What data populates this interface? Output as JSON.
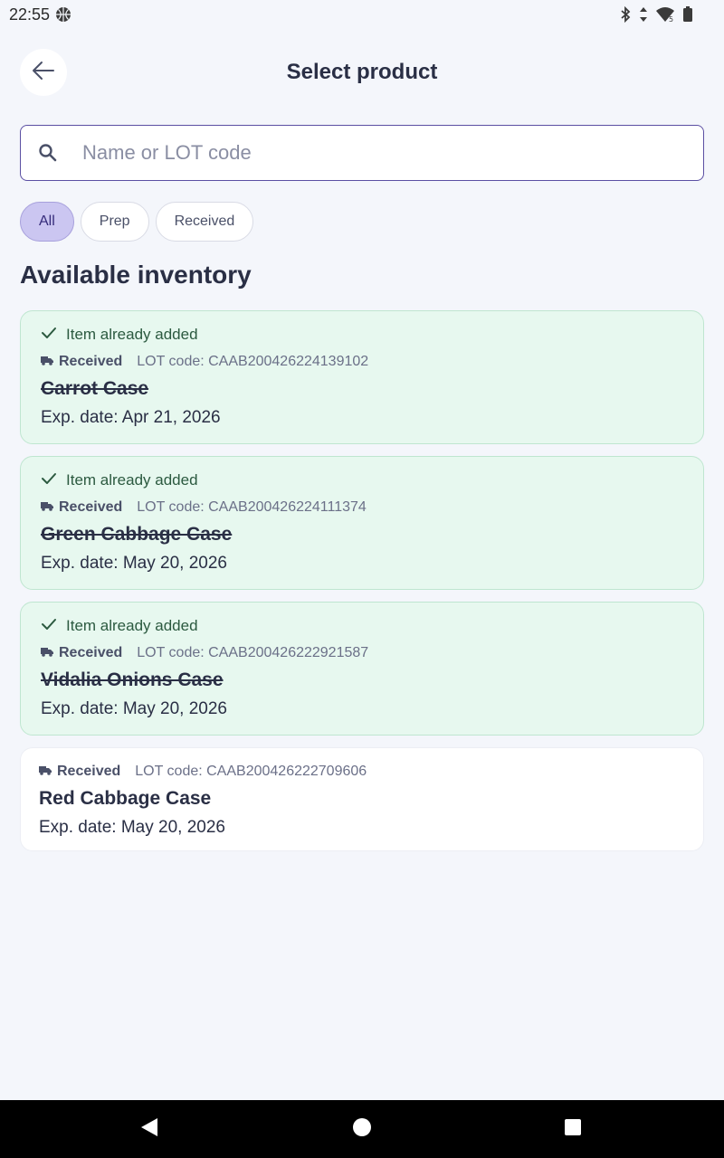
{
  "status_bar": {
    "time": "22:55"
  },
  "header": {
    "title": "Select product"
  },
  "search": {
    "placeholder": "Name or LOT code",
    "value": ""
  },
  "filters": [
    {
      "label": "All",
      "active": true
    },
    {
      "label": "Prep",
      "active": false
    },
    {
      "label": "Received",
      "active": false
    }
  ],
  "section_title": "Available inventory",
  "items": [
    {
      "added_label": "Item already added",
      "status": "Received",
      "lot": "LOT code: CAAB200426224139102",
      "name": "Carrot Case",
      "exp": "Exp. date: Apr 21, 2026"
    },
    {
      "added_label": "Item already added",
      "status": "Received",
      "lot": "LOT code: CAAB200426224111374",
      "name": "Green Cabbage Case",
      "exp": "Exp. date: May 20, 2026"
    },
    {
      "added_label": "Item already added",
      "status": "Received",
      "lot": "LOT code: CAAB200426222921587",
      "name": "Vidalia Onions Case",
      "exp": "Exp. date: May 20, 2026"
    },
    {
      "status": "Received",
      "lot": "LOT code: CAAB200426222709606",
      "name": "Red Cabbage Case",
      "exp": "Exp. date: May 20, 2026"
    }
  ],
  "colors": {
    "accent": "#5b4fa3",
    "added_bg": "#e7f8ef",
    "chip_active": "#cbc6f1"
  }
}
